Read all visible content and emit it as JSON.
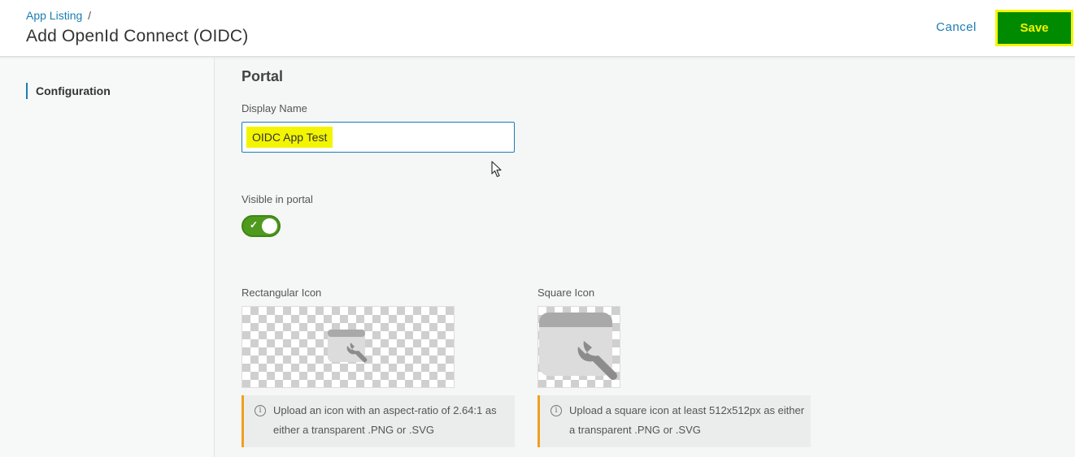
{
  "header": {
    "breadcrumb": "App Listing",
    "breadcrumb_sep": "/",
    "title": "Add OpenId Connect (OIDC)",
    "cancel_label": "Cancel",
    "save_label": "Save"
  },
  "sidebar": {
    "items": [
      {
        "label": "Configuration",
        "active": true
      }
    ]
  },
  "portal": {
    "section_title": "Portal",
    "display_name_label": "Display Name",
    "display_name_value": "OIDC App Test",
    "visible_label": "Visible in portal",
    "visible_on": true,
    "visible_check": "✓",
    "rect_icon_label": "Rectangular Icon",
    "rect_icon_info": "Upload an icon with an aspect-ratio of 2.64:1 as either a transparent .PNG or .SVG",
    "square_icon_label": "Square Icon",
    "square_icon_info": "Upload a square icon at least 512x512px as either a transparent .PNG or .SVG",
    "info_glyph": "i"
  },
  "colors": {
    "accent": "#1a7db5",
    "save_bg": "#008a00",
    "highlight": "#f3f500",
    "toggle_on": "#4e9a1f",
    "info_border": "#f0a020"
  }
}
